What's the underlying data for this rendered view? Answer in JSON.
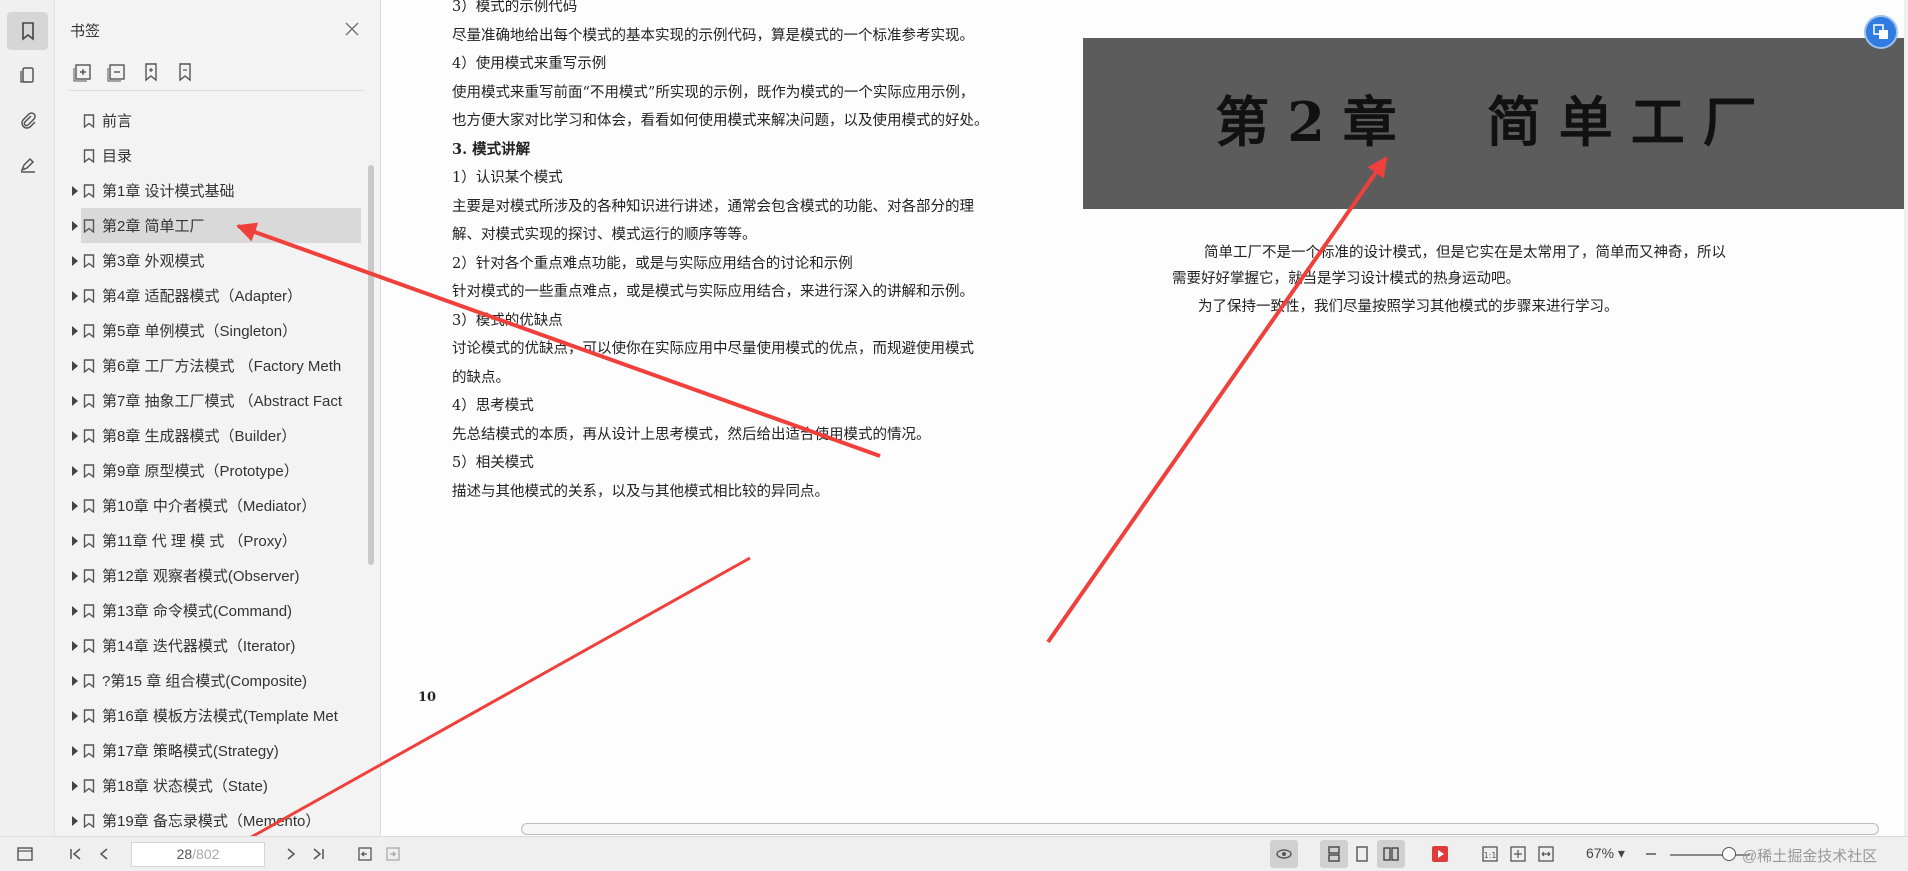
{
  "sidebar": {
    "title": "书签",
    "bookmarks": [
      {
        "label": "前言",
        "expandable": false
      },
      {
        "label": "目录",
        "expandable": false
      },
      {
        "label": "第1章 设计模式基础",
        "expandable": true
      },
      {
        "label": "第2章 简单工厂",
        "expandable": true,
        "selected": true
      },
      {
        "label": "第3章 外观模式",
        "expandable": true
      },
      {
        "label": "第4章 适配器模式（Adapter）",
        "expandable": true
      },
      {
        "label": "第5章 单例模式（Singleton）",
        "expandable": true
      },
      {
        "label": "第6章 工厂方法模式 （Factory Meth",
        "expandable": true
      },
      {
        "label": "第7章 抽象工厂模式 （Abstract Fact",
        "expandable": true
      },
      {
        "label": "第8章 生成器模式（Builder）",
        "expandable": true
      },
      {
        "label": "第9章 原型模式（Prototype）",
        "expandable": true
      },
      {
        "label": "第10章 中介者模式（Mediator）",
        "expandable": true
      },
      {
        "label": "第11章 代 理 模 式 （Proxy）",
        "expandable": true
      },
      {
        "label": "第12章 观察者模式(Observer)",
        "expandable": true
      },
      {
        "label": "第13章 命令模式(Command)",
        "expandable": true
      },
      {
        "label": "第14章 迭代器模式（Iterator)",
        "expandable": true
      },
      {
        "label": "?第15 章 组合模式(Composite)",
        "expandable": true
      },
      {
        "label": "第16章 模板方法模式(Template Met",
        "expandable": true
      },
      {
        "label": "第17章 策略模式(Strategy)",
        "expandable": true
      },
      {
        "label": "第18章 状态模式（State)",
        "expandable": true
      },
      {
        "label": "第19章 备忘录模式（Memento）",
        "expandable": true
      }
    ]
  },
  "left_page": {
    "lines": [
      "3）模式的示例代码",
      "尽量准确地给出每个模式的基本实现的示例代码，算是模式的一个标准参考实现。",
      "4）使用模式来重写示例",
      "使用模式来重写前面“不用模式”所实现的示例，既作为模式的一个实际应用示例，",
      "也方便大家对比学习和体会，看看如何使用模式来解决问题，以及使用模式的好处。",
      "3. 模式讲解",
      "1）认识某个模式",
      "主要是对模式所涉及的各种知识进行讲述，通常会包含模式的功能、对各部分的理",
      "解、对模式实现的探讨、模式运行的顺序等等。",
      "2）针对各个重点难点功能，或是与实际应用结合的讨论和示例",
      "针对模式的一些重点难点，或是模式与实际应用结合，来进行深入的讲解和示例。",
      "3）模式的优缺点",
      "讨论模式的优缺点，可以使你在实际应用中尽量使用模式的优点，而规避使用模式",
      "的缺点。",
      "4）思考模式",
      "先总结模式的本质，再从设计上思考模式，然后给出适合使用模式的情况。",
      "5）相关模式",
      "描述与其他模式的关系，以及与其他模式相比较的异同点。"
    ],
    "page_number": "10"
  },
  "right_page": {
    "chapter_title": "第2章　简单工厂",
    "lines": [
      "简单工厂不是一个标准的设计模式，但是它实在是太常用了，简单而又神奇，所以",
      "需要好好掌握它，就当是学习设计模式的热身运动吧。",
      "为了保持一致性，我们尽量按照学习其他模式的步骤来进行学习。"
    ]
  },
  "statusbar": {
    "current_page": "28",
    "total_pages": "/802",
    "zoom": "67%",
    "watermark": "@稀土掘金技术社区"
  },
  "colors": {
    "arrow": "#f0403c",
    "banner": "#5c5c5c",
    "selected_bg": "#d9d9d9",
    "fab": "#2f7be0"
  }
}
